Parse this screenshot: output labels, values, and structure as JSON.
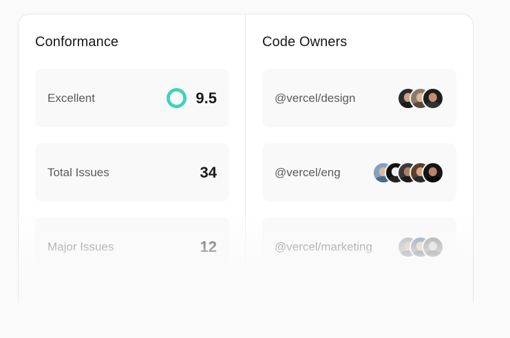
{
  "conformance": {
    "title": "Conformance",
    "score": {
      "label": "Excellent",
      "value": "9.5",
      "ring_color": "#3fd3b8"
    },
    "total_issues": {
      "label": "Total Issues",
      "value": "34"
    },
    "major_issues": {
      "label": "Major Issues",
      "value": "12"
    }
  },
  "code_owners": {
    "title": "Code Owners",
    "teams": [
      {
        "handle": "@vercel/design",
        "avatar_count": 3
      },
      {
        "handle": "@vercel/eng",
        "avatar_count": 5
      },
      {
        "handle": "@vercel/marketing",
        "avatar_count": 3
      }
    ]
  }
}
